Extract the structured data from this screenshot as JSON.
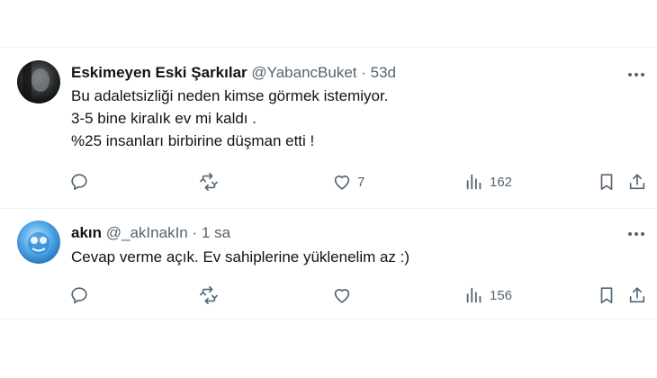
{
  "tweets": [
    {
      "author_name": "Eskimeyen Eski Şarkılar",
      "handle": "@YabancBuket",
      "separator": "·",
      "time": "53d",
      "lines": [
        "Bu adaletsizliği neden kimse görmek istemiyor.",
        "3-5 bine kiralık ev mi kaldı .",
        "%25 insanları birbirine düşman etti !"
      ],
      "replies": "",
      "retweets": "",
      "likes": "7",
      "views": "162"
    },
    {
      "author_name": "akın",
      "handle": "@_akInakIn",
      "separator": "·",
      "time": "1 sa",
      "lines": [
        "Cevap verme açık. Ev sahiplerine yüklenelim az :)"
      ],
      "replies": "",
      "retweets": "",
      "likes": "",
      "views": "156"
    }
  ],
  "colors": {
    "text": "#0f1419",
    "secondary": "#536471",
    "divider": "#eff3f4"
  }
}
